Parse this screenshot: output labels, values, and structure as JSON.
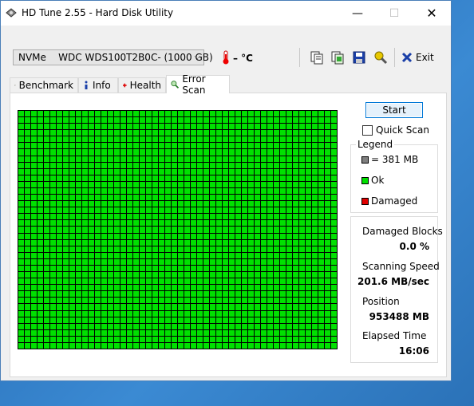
{
  "window": {
    "title": "HD Tune 2.55 - Hard Disk Utility",
    "min": "—",
    "max": "☐",
    "close": "✕"
  },
  "toolbar": {
    "drive": "NVMe    WDC WDS100T2B0C- (1000 GB)",
    "temperature": "– °C",
    "exit_label": "Exit"
  },
  "tabs": [
    {
      "label": "Benchmark",
      "icon": "lightbulb-icon"
    },
    {
      "label": "Info",
      "icon": "info-icon"
    },
    {
      "label": "Health",
      "icon": "health-cross-icon"
    },
    {
      "label": "Error Scan",
      "icon": "magnifier-icon",
      "active": true
    }
  ],
  "scan": {
    "start_label": "Start",
    "quick_scan_label": "Quick Scan",
    "quick_scan_checked": false,
    "grid_rows": 37,
    "grid_cols": 50,
    "block_state": "ok"
  },
  "legend": {
    "title": "Legend",
    "items": [
      {
        "label": "= 381 MB",
        "color": "#808080"
      },
      {
        "label": "Ok",
        "color": "#00e000"
      },
      {
        "label": "Damaged",
        "color": "#e00000"
      }
    ]
  },
  "stats": {
    "damaged_label": "Damaged Blocks",
    "damaged_value": "0.0 %",
    "speed_label": "Scanning Speed",
    "speed_value": "201.6 MB/sec",
    "position_label": "Position",
    "position_value": "953488 MB",
    "elapsed_label": "Elapsed Time",
    "elapsed_value": "16:06"
  },
  "colors": {
    "ok": "#00e000",
    "damaged": "#e00000",
    "accent": "#0078d7"
  }
}
